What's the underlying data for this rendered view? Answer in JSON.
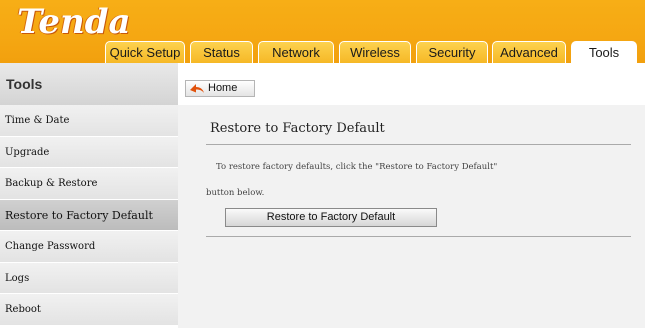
{
  "brand": {
    "logo_text": "Tenda"
  },
  "tabs": [
    {
      "label": "Quick Setup"
    },
    {
      "label": "Status"
    },
    {
      "label": "Network"
    },
    {
      "label": "Wireless"
    },
    {
      "label": "Security"
    },
    {
      "label": "Advanced"
    },
    {
      "label": "Tools",
      "active": true
    }
  ],
  "sidebar": {
    "title": "Tools",
    "items": [
      {
        "label": "Time & Date"
      },
      {
        "label": "Upgrade"
      },
      {
        "label": "Backup & Restore"
      },
      {
        "label": "Restore to Factory Default",
        "active": true
      },
      {
        "label": "Change Password"
      },
      {
        "label": "Logs"
      },
      {
        "label": "Reboot"
      }
    ]
  },
  "breadcrumb": {
    "home_label": "Home"
  },
  "main": {
    "title": "Restore to Factory Default",
    "description_line1": "To restore factory defaults, click the \"Restore to Factory Default\"",
    "description_line2": "button below.",
    "button_label": "Restore to Factory Default"
  },
  "colors": {
    "header": "#f5a712",
    "logo_accent": "#e14b0a"
  }
}
